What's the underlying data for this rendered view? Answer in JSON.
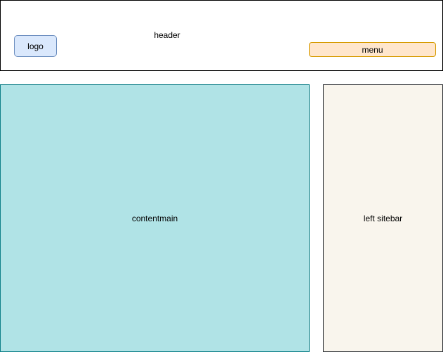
{
  "header": {
    "label": "header",
    "logo_label": "logo",
    "menu_label": "menu"
  },
  "content": {
    "label": "contentmain"
  },
  "sidebar": {
    "label": "left sitebar"
  },
  "colors": {
    "logo_fill": "#dae8fc",
    "logo_stroke": "#6c8ebf",
    "menu_fill": "#ffe6cc",
    "menu_stroke": "#d79b00",
    "content_fill": "#b0e3e6",
    "content_stroke": "#0e8088",
    "sidebar_fill": "#f9f5ed",
    "sidebar_stroke": "#36393d"
  }
}
